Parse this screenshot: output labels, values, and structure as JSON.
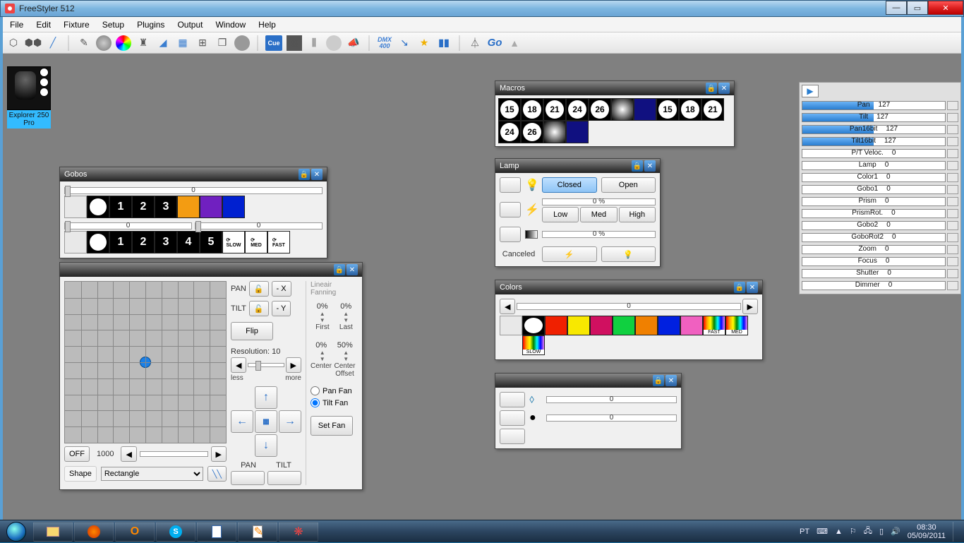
{
  "window": {
    "title": "FreeStyler 512"
  },
  "menu": [
    "File",
    "Edit",
    "Fixture",
    "Setup",
    "Plugins",
    "Output",
    "Window",
    "Help"
  ],
  "fixture": {
    "name": "Explorer 250 Pro"
  },
  "panels": {
    "gobos": {
      "title": "Gobos",
      "slider1": "0",
      "slider2a": "0",
      "slider2b": "0",
      "row1": [
        "○",
        "1",
        "2",
        "3"
      ],
      "row2": [
        "○",
        "1",
        "2",
        "3",
        "4",
        "5",
        "⟳slow",
        "⟳med",
        "⟳fast"
      ]
    },
    "pantilt": {
      "pan_label": "PAN",
      "tilt_label": "TILT",
      "x_btn": "- X",
      "y_btn": "- Y",
      "flip": "Flip",
      "res_label": "Resolution: 10",
      "less": "less",
      "more": "more",
      "off": "OFF",
      "pos": "1000",
      "shape": "Shape",
      "shape_opt": "Rectangle",
      "pan2": "PAN",
      "tilt2": "TILT",
      "fan_title": "Lineair Fanning",
      "fan_first_pct": "0%",
      "fan_last_pct": "0%",
      "fan_first": "First",
      "fan_last": "Last",
      "fan_center_pct": "0%",
      "fan_off_pct": "50%",
      "fan_center": "Center",
      "fan_centeroff": "Center Offset",
      "panfan": "Pan Fan",
      "tiltfan": "Tilt Fan",
      "setfan": "Set Fan"
    },
    "macros": {
      "title": "Macros",
      "row1": [
        "15",
        "18",
        "21",
        "24",
        "26",
        "",
        "",
        "15",
        "18",
        "21"
      ],
      "row2": [
        "24",
        "26",
        "",
        ""
      ]
    },
    "lamp": {
      "title": "Lamp",
      "closed": "Closed",
      "open": "Open",
      "pct1": "0 %",
      "low": "Low",
      "med": "Med",
      "high": "High",
      "pct2": "0 %",
      "canceled": "Canceled"
    },
    "colors": {
      "title": "Colors",
      "slider": "0"
    },
    "prismpanel": {
      "val1": "0",
      "val2": "0"
    }
  },
  "params": [
    {
      "name": "Pan",
      "val": "127",
      "fill": 50
    },
    {
      "name": "Tilt",
      "val": "127",
      "fill": 50
    },
    {
      "name": "Pan16bit",
      "val": "127",
      "fill": 50
    },
    {
      "name": "Tilt16bit",
      "val": "127",
      "fill": 50
    },
    {
      "name": "P/T Veloc.",
      "val": "0",
      "fill": 0
    },
    {
      "name": "Lamp",
      "val": "0",
      "fill": 0
    },
    {
      "name": "Color1",
      "val": "0",
      "fill": 0
    },
    {
      "name": "Gobo1",
      "val": "0",
      "fill": 0
    },
    {
      "name": "Prism",
      "val": "0",
      "fill": 0
    },
    {
      "name": "PrismRot.",
      "val": "0",
      "fill": 0
    },
    {
      "name": "Gobo2",
      "val": "0",
      "fill": 0
    },
    {
      "name": "GoboRot2",
      "val": "0",
      "fill": 0
    },
    {
      "name": "Zoom",
      "val": "0",
      "fill": 0
    },
    {
      "name": "Focus",
      "val": "0",
      "fill": 0
    },
    {
      "name": "Shutter",
      "val": "0",
      "fill": 0
    },
    {
      "name": "Dimmer",
      "val": "0",
      "fill": 0
    }
  ],
  "tray": {
    "lang": "PT",
    "time": "08:30",
    "date": "05/09/2011"
  }
}
